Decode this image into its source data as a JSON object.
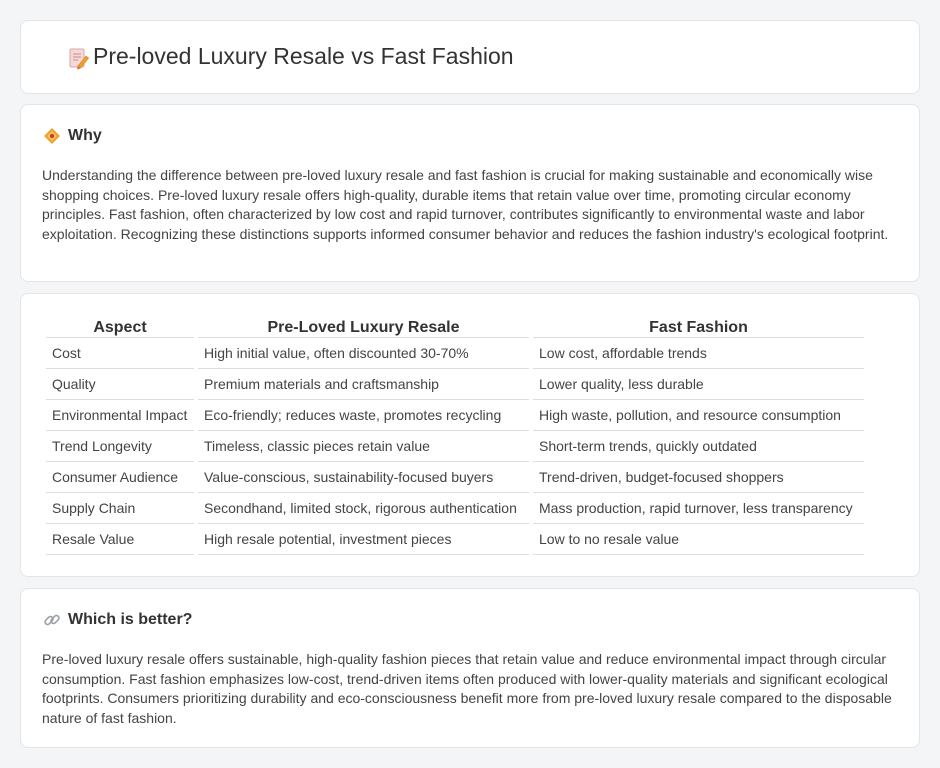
{
  "header": {
    "title": "Pre-loved Luxury Resale vs Fast Fashion",
    "icon": "document-pencil-icon"
  },
  "why": {
    "heading": "Why",
    "icon": "diamond-icon",
    "text": "Understanding the difference between pre-loved luxury resale and fast fashion is crucial for making sustainable and economically wise shopping choices. Pre-loved luxury resale offers high-quality, durable items that retain value over time, promoting circular economy principles. Fast fashion, often characterized by low cost and rapid turnover, contributes significantly to environmental waste and labor exploitation. Recognizing these distinctions supports informed consumer behavior and reduces the fashion industry's ecological footprint."
  },
  "table": {
    "headers": [
      "Aspect",
      "Pre-Loved Luxury Resale",
      "Fast Fashion"
    ],
    "rows": [
      [
        "Cost",
        "High initial value, often discounted 30-70%",
        "Low cost, affordable trends"
      ],
      [
        "Quality",
        "Premium materials and craftsmanship",
        "Lower quality, less durable"
      ],
      [
        "Environmental Impact",
        "Eco-friendly; reduces waste, promotes recycling",
        "High waste, pollution, and resource consumption"
      ],
      [
        "Trend Longevity",
        "Timeless, classic pieces retain value",
        "Short-term trends, quickly outdated"
      ],
      [
        "Consumer Audience",
        "Value-conscious, sustainability-focused buyers",
        "Trend-driven, budget-focused shoppers"
      ],
      [
        "Supply Chain",
        "Secondhand, limited stock, rigorous authentication",
        "Mass production, rapid turnover, less transparency"
      ],
      [
        "Resale Value",
        "High resale potential, investment pieces",
        "Low to no resale value"
      ]
    ]
  },
  "better": {
    "heading": "Which is better?",
    "icon": "link-icon",
    "text": "Pre-loved luxury resale offers sustainable, high-quality fashion pieces that retain value and reduce environmental impact through circular consumption. Fast fashion emphasizes low-cost, trend-driven items often produced with lower-quality materials and significant ecological footprints. Consumers prioritizing durability and eco-consciousness benefit more from pre-loved luxury resale compared to the disposable nature of fast fashion."
  },
  "colors": {
    "background": "#f4f5f7",
    "card": "#ffffff",
    "accent": "#f0a030"
  }
}
